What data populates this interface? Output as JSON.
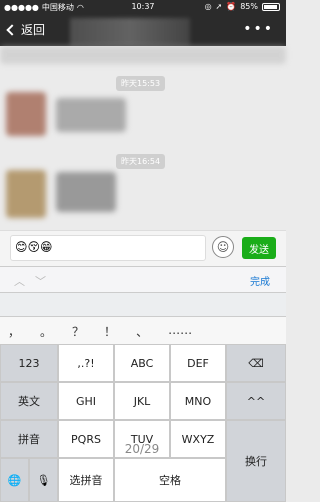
{
  "status": {
    "carrier": "中国移动",
    "signal_icon": "signal-icon",
    "wifi_icon": "wifi-icon",
    "time": "10:37",
    "battery": "85%"
  },
  "nav": {
    "back_label": "返回",
    "more_label": "•••"
  },
  "chat": {
    "time1": "昨天15:53",
    "time2": "昨天16:54"
  },
  "input": {
    "text": "😊😚😁",
    "emoji_icon": "emoji-icon",
    "send_label": "发送"
  },
  "toolbar": {
    "done_label": "完成",
    "up_icon": "chevron-up-icon",
    "down_icon": "chevron-down-icon"
  },
  "candidates": [
    "，",
    "。",
    "？",
    "！",
    "、",
    "……"
  ],
  "keyboard": {
    "row1": {
      "num": "123",
      "k1": ",.?!",
      "k2": "ABC",
      "k3": "DEF",
      "del_icon": "backspace-icon"
    },
    "row2": {
      "en": "英文",
      "k1": "GHI",
      "k2": "JKL",
      "k3": "MNO",
      "face": "^^"
    },
    "row3": {
      "py": "拼音",
      "k1": "PQRS",
      "k2": "TUV",
      "k3": "WXYZ",
      "enter": "换行",
      "page": "20/29"
    },
    "row4": {
      "globe_icon": "globe-icon",
      "mic_icon": "microphone-icon",
      "select_py": "选拼音",
      "space": "空格"
    }
  }
}
